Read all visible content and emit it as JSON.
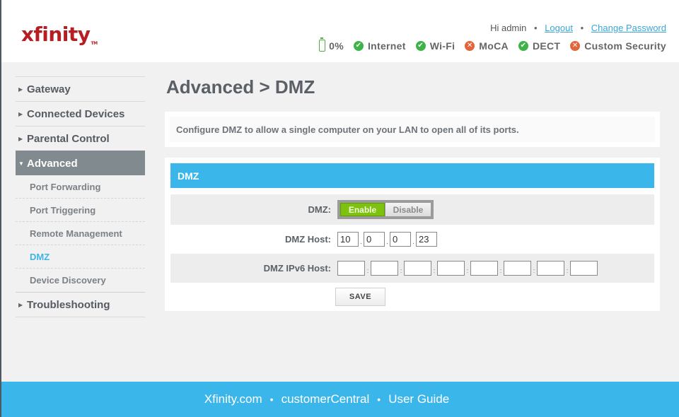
{
  "header": {
    "logo": "xfinity",
    "logo_tm": "TM",
    "greeting": "Hi admin",
    "logout": "Logout",
    "change_password": "Change Password",
    "separator": "•",
    "battery_label": "0%",
    "status": [
      {
        "label": "Internet",
        "state": "ok",
        "icon": "check-circle-icon"
      },
      {
        "label": "Wi-Fi",
        "state": "ok",
        "icon": "check-circle-icon"
      },
      {
        "label": "MoCA",
        "state": "error",
        "icon": "x-circle-icon"
      },
      {
        "label": "DECT",
        "state": "ok",
        "icon": "check-circle-icon"
      },
      {
        "label": "Custom Security",
        "state": "error",
        "icon": "x-circle-icon"
      }
    ]
  },
  "sidebar": {
    "items": [
      {
        "label": "Gateway"
      },
      {
        "label": "Connected Devices"
      },
      {
        "label": "Parental Control"
      },
      {
        "label": "Advanced",
        "expanded": true
      },
      {
        "label": "Troubleshooting"
      }
    ],
    "advanced_sub": [
      {
        "label": "Port Forwarding"
      },
      {
        "label": "Port Triggering"
      },
      {
        "label": "Remote Management"
      },
      {
        "label": "DMZ",
        "current": true
      },
      {
        "label": "Device Discovery"
      }
    ]
  },
  "main": {
    "title": "Advanced > DMZ",
    "description": "Configure DMZ to allow a single computer on your LAN to open all of its ports.",
    "section_title": "DMZ",
    "dmz_label": "DMZ:",
    "enable_label": "Enable",
    "disable_label": "Disable",
    "dmz_state": "Enable",
    "host_label": "DMZ Host:",
    "host_octets": [
      "10",
      "0",
      "0",
      "23"
    ],
    "ipv6_label": "DMZ IPv6 Host:",
    "ipv6_groups": [
      "",
      "",
      "",
      "",
      "",
      "",
      "",
      ""
    ],
    "save_label": "SAVE"
  },
  "footer": {
    "links": [
      "Xfinity.com",
      "customerCentral",
      "User Guide"
    ],
    "separator": "•"
  },
  "colors": {
    "brand_red": "#b51f24",
    "accent_blue": "#3bb6eb",
    "ok_green": "#3db34a",
    "error_orange": "#e2653d",
    "enable_green": "#7cc20e"
  }
}
